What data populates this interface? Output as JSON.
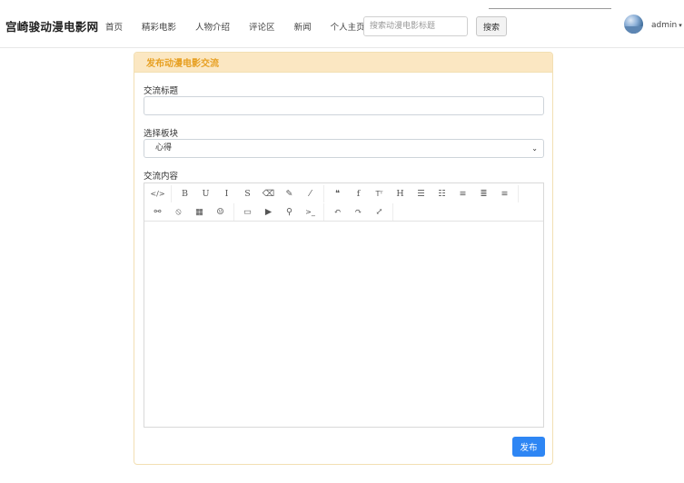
{
  "header": {
    "brand": "宫崎骏动漫电影网",
    "nav": [
      "首页",
      "精彩电影",
      "人物介绍",
      "评论区",
      "新闻",
      "个人主页"
    ],
    "search": {
      "placeholder": "搜索动漫电影标题",
      "button": "搜索"
    },
    "user": {
      "name": "admin",
      "caret": "▾"
    }
  },
  "form": {
    "title": "发布动漫电影交流",
    "title_label": "交流标题",
    "title_value": "",
    "board_label": "选择板块",
    "board_value": "心得",
    "board_arrow": "⌄",
    "content_label": "交流内容",
    "submit": "发布"
  },
  "toolbar": {
    "row1": [
      [
        {
          "icon": "code-view-icon",
          "glyph": "</>"
        }
      ],
      [
        {
          "icon": "bold-icon",
          "glyph": "B"
        },
        {
          "icon": "underline-icon",
          "glyph": "U"
        },
        {
          "icon": "italic-icon",
          "glyph": "I"
        },
        {
          "icon": "strikethrough-icon",
          "glyph": "S"
        },
        {
          "icon": "eraser-icon",
          "glyph": "⌫"
        },
        {
          "icon": "pen-icon",
          "glyph": "✎"
        },
        {
          "icon": "brush-icon",
          "glyph": "⁄"
        }
      ],
      [
        {
          "icon": "quote-icon",
          "glyph": "❝"
        },
        {
          "icon": "font-icon",
          "glyph": "f"
        },
        {
          "icon": "font-size-icon",
          "glyph": "Tᵀ"
        },
        {
          "icon": "heading-icon",
          "glyph": "H"
        },
        {
          "icon": "bullet-list-icon",
          "glyph": "☰"
        },
        {
          "icon": "ordered-list-icon",
          "glyph": "☷"
        },
        {
          "icon": "align-left-icon",
          "glyph": "≡"
        },
        {
          "icon": "align-center-icon",
          "glyph": "≣"
        },
        {
          "icon": "align-right-icon",
          "glyph": "≡"
        }
      ]
    ],
    "row2": [
      [
        {
          "icon": "link-icon",
          "glyph": "⚯"
        },
        {
          "icon": "unlink-icon",
          "glyph": "⦸"
        },
        {
          "icon": "table-icon",
          "glyph": "▦"
        },
        {
          "icon": "emoji-icon",
          "glyph": "☺"
        }
      ],
      [
        {
          "icon": "image-icon",
          "glyph": "▭"
        },
        {
          "icon": "video-icon",
          "glyph": "▶"
        },
        {
          "icon": "location-icon",
          "glyph": "⚲"
        },
        {
          "icon": "code-block-icon",
          "glyph": ">_"
        }
      ],
      [
        {
          "icon": "undo-icon",
          "glyph": "↶"
        },
        {
          "icon": "redo-icon",
          "glyph": "↷"
        },
        {
          "icon": "fullscreen-icon",
          "glyph": "⤢"
        }
      ]
    ]
  }
}
